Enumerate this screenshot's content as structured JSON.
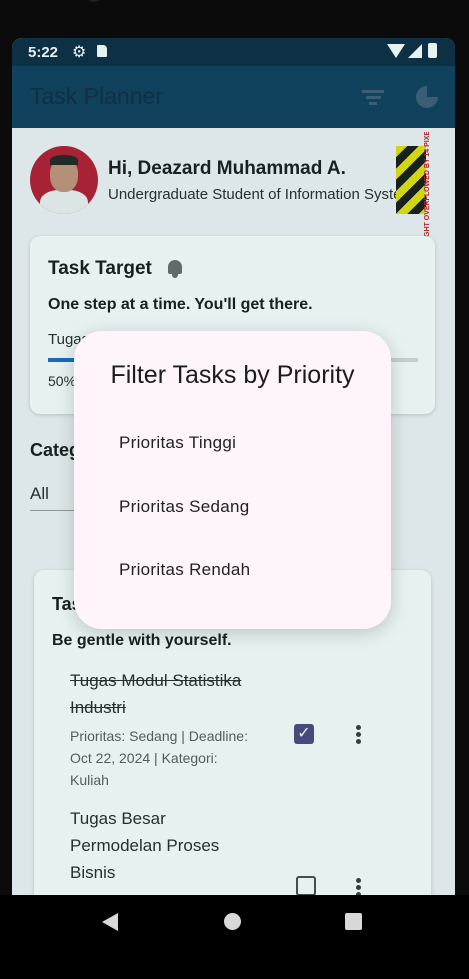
{
  "status_bar": {
    "time": "5:22",
    "icons": [
      "gear-icon",
      "sd-card-icon",
      "wifi-icon",
      "signal-icon",
      "battery-icon"
    ]
  },
  "app_bar": {
    "title": "Task Planner",
    "icons": [
      "filter-icon",
      "pie-chart-icon"
    ]
  },
  "profile": {
    "greeting": "Hi, Deazard Muhammad A.",
    "subtitle": "Undergraduate Student of Information Systems",
    "overflow_warning": "RIGHT OVERFLOWED BY 14 PIXELS"
  },
  "task_target": {
    "title": "Task Target",
    "motto": "One step at a time. You'll get there.",
    "progress_label": "Tugas",
    "progress_value": 0.5,
    "percent_text": "50%"
  },
  "category": {
    "label": "Categories",
    "selected": "All"
  },
  "task_list": {
    "title": "Tasks",
    "motto": "Be gentle with yourself.",
    "tasks": [
      {
        "name": "Tugas Modul Statistika Industri",
        "meta": "Prioritas: Sedang | Deadline: Oct 22, 2024 | Kategori: Kuliah",
        "done": true
      },
      {
        "name": "Tugas Besar Permodelan Proses Bisnis",
        "meta": "",
        "done": false
      }
    ]
  },
  "dialog": {
    "title": "Filter Tasks by Priority",
    "options": [
      "Prioritas Tinggi",
      "Prioritas Sedang",
      "Prioritas Rendah"
    ]
  },
  "colors": {
    "app_bar": "#0a3557",
    "status_bar": "#07223a",
    "dialog_bg": "#fdf5fb",
    "progress": "#1565c0",
    "checkbox": "#4a3f7a"
  }
}
